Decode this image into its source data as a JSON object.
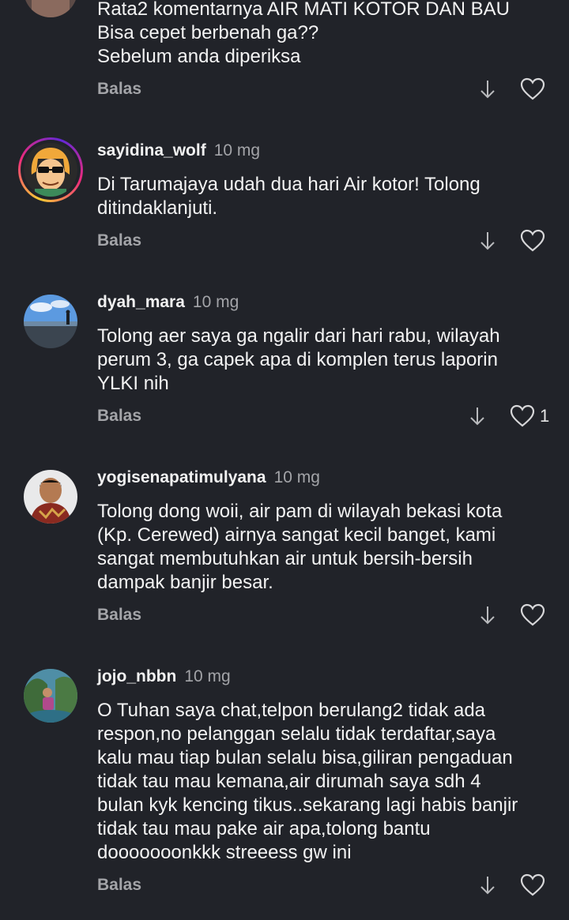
{
  "reply_label": "Balas",
  "colors": {
    "background": "#212329",
    "text": "#f3f3f3",
    "muted": "#a3a4a8"
  },
  "comments": [
    {
      "username": "",
      "time": "",
      "lines": [
        "Rata2 komentarnya AIR MATI KOTOR DAN BAU",
        "Bisa cepet berbenah ga??",
        "Sebelum anda diperiksa"
      ],
      "likes": ""
    },
    {
      "username": "sayidina_wolf",
      "time": "10 mg",
      "lines": [
        "Di Tarumajaya udah dua hari Air kotor! Tolong",
        "ditindaklanjuti."
      ],
      "likes": ""
    },
    {
      "username": "dyah_mara",
      "time": "10 mg",
      "lines": [
        "Tolong aer saya ga ngalir dari hari rabu, wilayah",
        "perum 3, ga capek apa di komplen terus laporin",
        "YLKI nih"
      ],
      "likes": "1"
    },
    {
      "username": "yogisenapatimulyana",
      "time": "10 mg",
      "lines": [
        "Tolong dong woii, air pam di wilayah bekasi kota",
        "(Kp. Cerewed) airnya sangat kecil banget, kami",
        "sangat membutuhkan air untuk bersih-bersih",
        "dampak banjir besar."
      ],
      "likes": ""
    },
    {
      "username": "jojo_nbbn",
      "time": "10 mg",
      "lines": [
        "O Tuhan saya chat,telpon berulang2 tidak ada",
        "respon,no pelanggan selalu tidak terdaftar,saya",
        "kalu mau tiap bulan selalu bisa,giliran pengaduan",
        "tidak tau mau kemana,air dirumah saya sdh 4",
        "bulan kyk kencing tikus..sekarang lagi habis banjir",
        "tidak tau mau pake air apa,tolong bantu",
        "dooooooonkkk streeess gw ini"
      ],
      "likes": ""
    }
  ]
}
